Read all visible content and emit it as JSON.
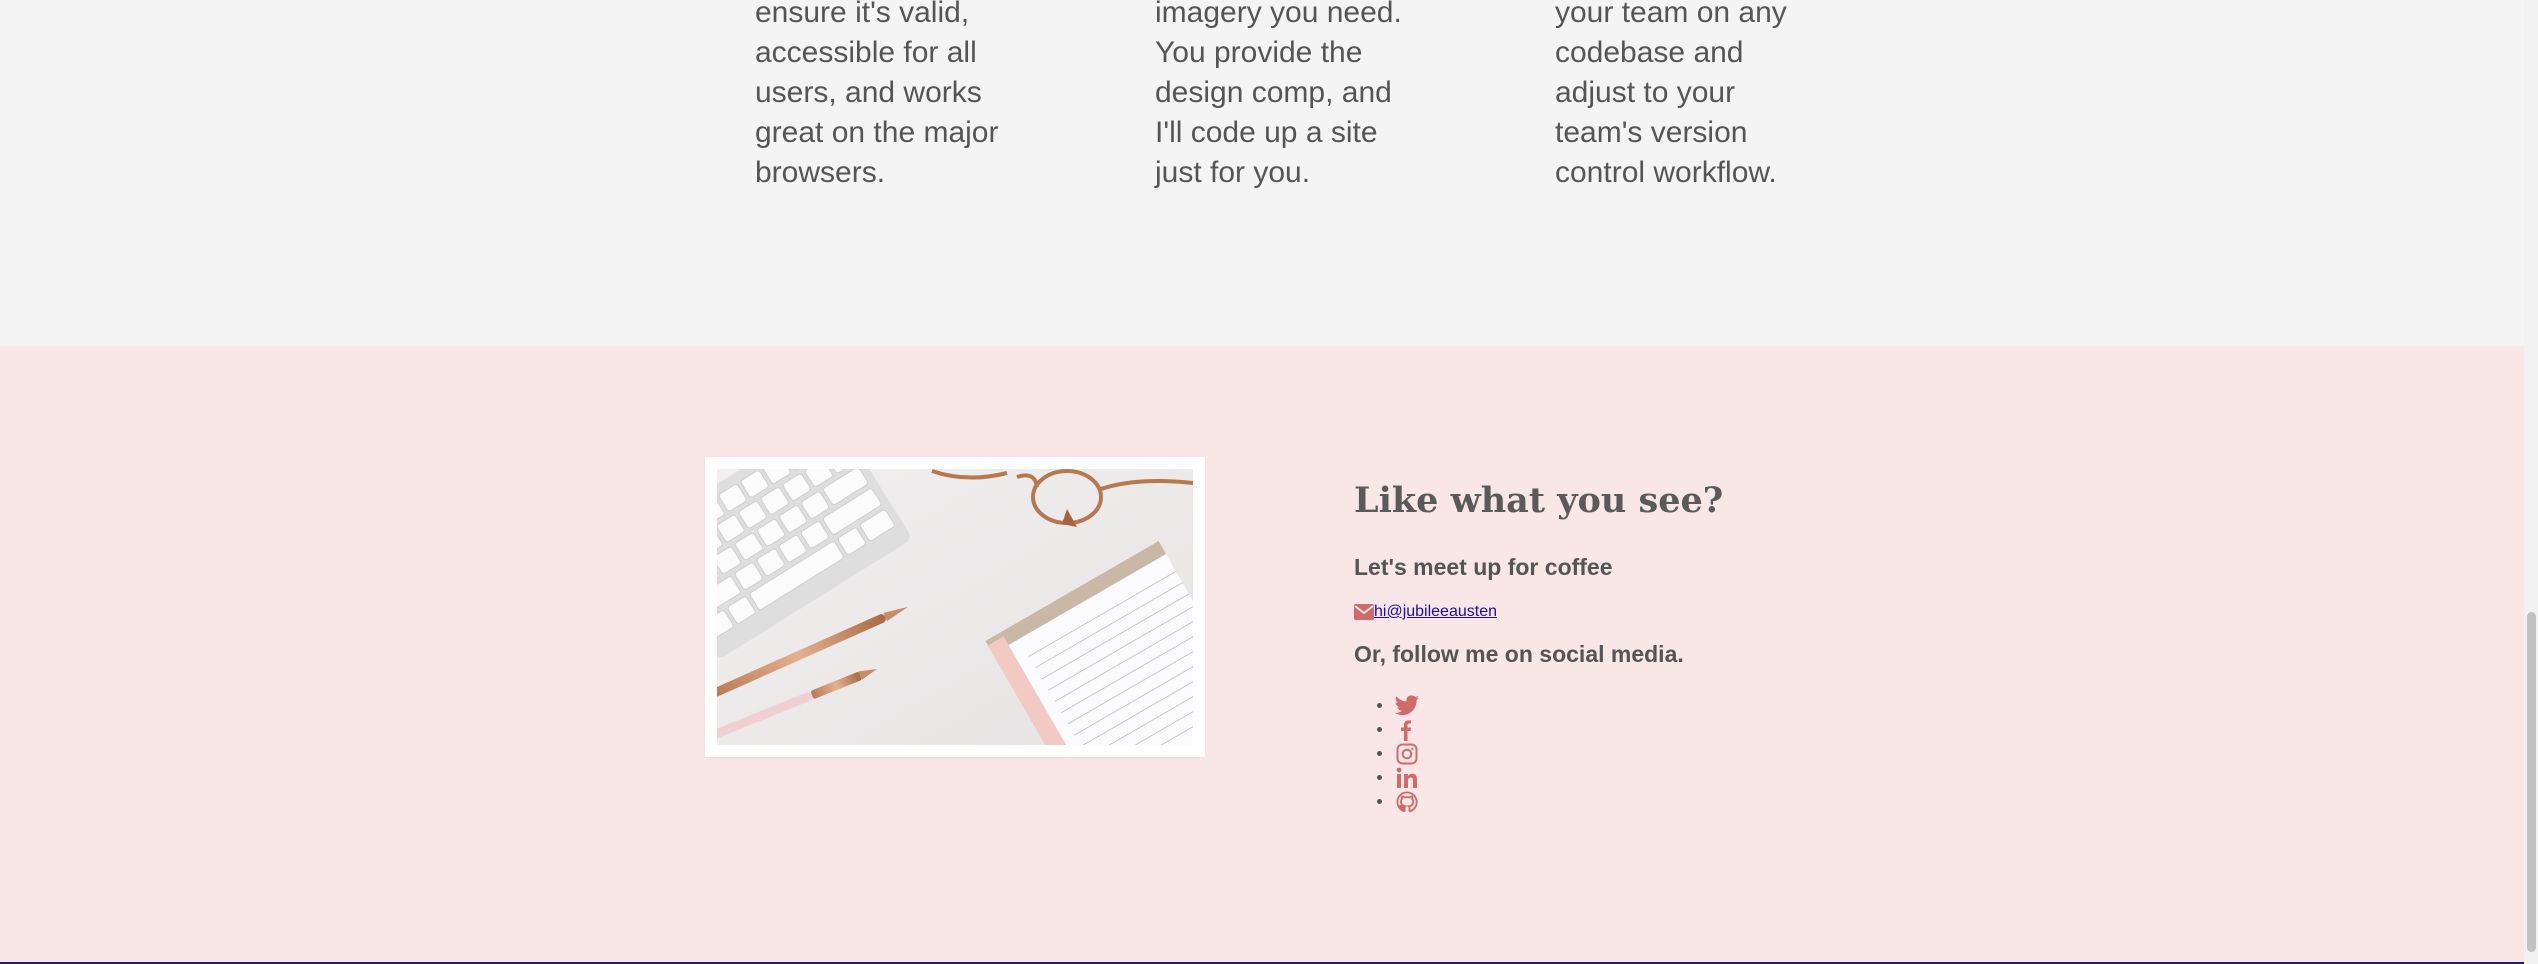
{
  "services": [
    {
      "text": "ensure it's valid, accessible for all users, and works great on the major browsers."
    },
    {
      "text": "imagery you need. You provide the design comp, and I'll code up a site just for you."
    },
    {
      "text": "your team on any codebase and adjust to your team's version control workflow."
    }
  ],
  "contact": {
    "title": "Like what you see?",
    "subtitle": "Let's meet up for coffee",
    "email_icon": "envelope-icon",
    "email": "hi@jubileeausten",
    "follow": "Or, follow me on social media.",
    "social": [
      {
        "icon": "twitter-icon"
      },
      {
        "icon": "facebook-icon"
      },
      {
        "icon": "instagram-icon"
      },
      {
        "icon": "linkedin-icon"
      },
      {
        "icon": "github-icon"
      }
    ]
  },
  "colors": {
    "accent": "#d16b6b",
    "contact_background": "#f9e6e6",
    "services_background": "#f4f4f4",
    "link": "#1a0dab"
  }
}
